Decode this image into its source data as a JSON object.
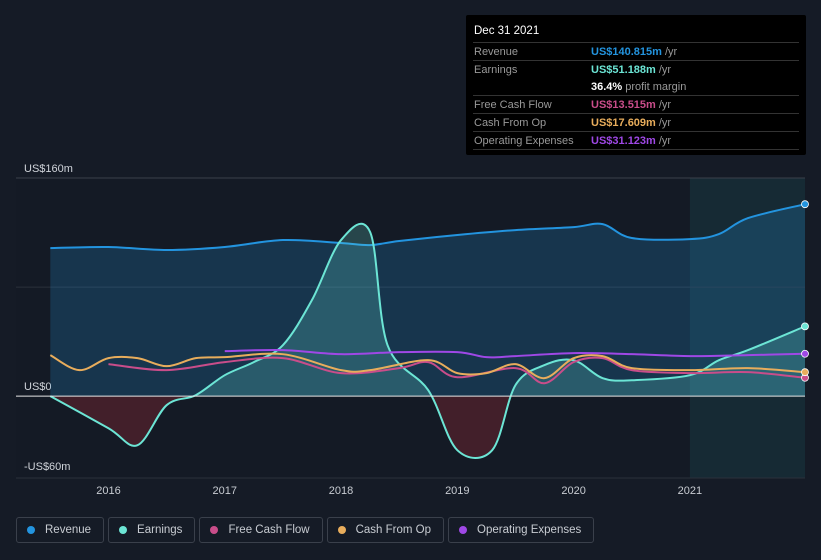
{
  "tooltip": {
    "date": "Dec 31 2021",
    "rows": [
      {
        "label": "Revenue",
        "value": "US$140.815m",
        "unit": "/yr",
        "color": "#2394df"
      },
      {
        "label": "Earnings",
        "value": "US$51.188m",
        "unit": "/yr",
        "color": "#6ce5d5"
      },
      {
        "label": "",
        "value": "36.4%",
        "unit": "profit margin",
        "color": "#ffffff"
      },
      {
        "label": "Free Cash Flow",
        "value": "US$13.515m",
        "unit": "/yr",
        "color": "#c94d8a"
      },
      {
        "label": "Cash From Op",
        "value": "US$17.609m",
        "unit": "/yr",
        "color": "#e8ad5c"
      },
      {
        "label": "Operating Expenses",
        "value": "US$31.123m",
        "unit": "/yr",
        "color": "#9f48e6"
      }
    ]
  },
  "legend": [
    {
      "label": "Revenue",
      "color": "#2394df"
    },
    {
      "label": "Earnings",
      "color": "#6ce5d5"
    },
    {
      "label": "Free Cash Flow",
      "color": "#c94d8a"
    },
    {
      "label": "Cash From Op",
      "color": "#e8ad5c"
    },
    {
      "label": "Operating Expenses",
      "color": "#9f48e6"
    }
  ],
  "chart_data": {
    "type": "line",
    "ylim": [
      -60,
      160
    ],
    "xlim": [
      2015.48,
      2021.99
    ],
    "y_ticks": [
      {
        "value": 160,
        "label": "US$160m"
      },
      {
        "value": 0,
        "label": "US$0"
      },
      {
        "value": -60,
        "label": "-US$60m"
      }
    ],
    "x_ticks": [
      {
        "value": 2016,
        "label": "2016"
      },
      {
        "value": 2017,
        "label": "2017"
      },
      {
        "value": 2018,
        "label": "2018"
      },
      {
        "value": 2019,
        "label": "2019"
      },
      {
        "value": 2020,
        "label": "2020"
      },
      {
        "value": 2021,
        "label": "2021"
      }
    ],
    "highlight_from": 2021,
    "series": [
      {
        "name": "Revenue",
        "color": "#2394df",
        "fill": true,
        "x": [
          2015.5,
          2016,
          2016.5,
          2017,
          2017.5,
          2018,
          2018.25,
          2018.5,
          2019,
          2019.5,
          2020,
          2020.25,
          2020.5,
          2021,
          2021.25,
          2021.5,
          2021.99
        ],
        "y": [
          108.6,
          109.4,
          107.2,
          109.4,
          114.5,
          112.3,
          110.8,
          113.8,
          118.2,
          121.8,
          124.0,
          126.2,
          116.0,
          115.2,
          118.9,
          130.6,
          140.8
        ]
      },
      {
        "name": "Earnings",
        "color": "#6ce5d5",
        "fill": true,
        "x": [
          2015.5,
          2016,
          2016.25,
          2016.5,
          2016.75,
          2017,
          2017.25,
          2017.5,
          2017.75,
          2018,
          2018.25,
          2018.4,
          2018.75,
          2019,
          2019.3,
          2019.5,
          2019.75,
          2020,
          2020.25,
          2020.5,
          2021,
          2021.25,
          2021.5,
          2021.99
        ],
        "y": [
          0,
          -23.5,
          -35.9,
          -6.6,
          0.7,
          15.4,
          25,
          37.4,
          70.5,
          114.5,
          120.4,
          37.4,
          4.4,
          -39.6,
          -39.6,
          8.1,
          22.8,
          26.4,
          13.2,
          11.7,
          15.4,
          26.4,
          33.8,
          51.2
        ]
      },
      {
        "name": "Free Cash Flow",
        "color": "#c94d8a",
        "fill": false,
        "x": [
          2016,
          2016.5,
          2017,
          2017.5,
          2018,
          2018.5,
          2018.75,
          2019,
          2019.5,
          2019.75,
          2020,
          2020.25,
          2020.5,
          2021,
          2021.5,
          2021.99
        ],
        "y": [
          23.5,
          19.1,
          25.0,
          27.9,
          16.9,
          20.6,
          25.0,
          13.9,
          20.6,
          9.5,
          25.0,
          27.9,
          19.1,
          16.9,
          17.6,
          13.5
        ]
      },
      {
        "name": "Cash From Op",
        "color": "#e8ad5c",
        "fill": false,
        "x": [
          2015.5,
          2015.75,
          2016,
          2016.25,
          2016.5,
          2016.75,
          2017,
          2017.5,
          2018,
          2018.25,
          2018.75,
          2019,
          2019.25,
          2019.5,
          2019.75,
          2020,
          2020.25,
          2020.5,
          2021,
          2021.5,
          2021.99
        ],
        "y": [
          30.1,
          19.1,
          27.9,
          27.9,
          22.0,
          27.9,
          28.6,
          30.8,
          19.1,
          19.1,
          26.4,
          16.9,
          16.9,
          23.5,
          13.2,
          27.9,
          29.4,
          20.6,
          19.1,
          20.6,
          17.6
        ]
      },
      {
        "name": "Operating Expenses",
        "color": "#9f48e6",
        "fill": false,
        "x": [
          2017,
          2017.5,
          2018,
          2018.5,
          2019,
          2019.25,
          2019.5,
          2020,
          2020.5,
          2021,
          2021.5,
          2021.99
        ],
        "y": [
          33.0,
          33.8,
          30.8,
          32.3,
          32.3,
          28.6,
          29.4,
          31.6,
          30.8,
          29.4,
          30.1,
          31.1
        ]
      }
    ]
  }
}
